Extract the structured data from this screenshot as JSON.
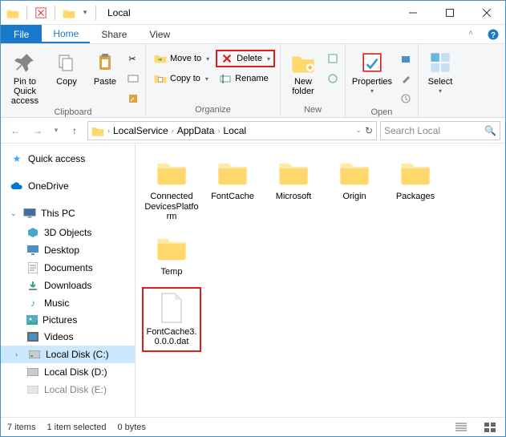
{
  "window": {
    "title": "Local"
  },
  "menu": {
    "file": "File",
    "home": "Home",
    "share": "Share",
    "view": "View"
  },
  "ribbon": {
    "clipboard": {
      "label": "Clipboard",
      "pin": "Pin to Quick access",
      "copy": "Copy",
      "paste": "Paste"
    },
    "organize": {
      "label": "Organize",
      "moveto": "Move to",
      "copyto": "Copy to",
      "delete": "Delete",
      "rename": "Rename"
    },
    "new": {
      "label": "New",
      "newfolder": "New folder"
    },
    "open": {
      "label": "Open",
      "properties": "Properties"
    },
    "select": {
      "label": "Select",
      "select": "Select"
    }
  },
  "breadcrumb": {
    "c1": "LocalService",
    "c2": "AppData",
    "c3": "Local"
  },
  "search": {
    "placeholder": "Search Local"
  },
  "sidebar": {
    "quick": "Quick access",
    "onedrive": "OneDrive",
    "thispc": "This PC",
    "objects3d": "3D Objects",
    "desktop": "Desktop",
    "documents": "Documents",
    "downloads": "Downloads",
    "music": "Music",
    "pictures": "Pictures",
    "videos": "Videos",
    "diskc": "Local Disk (C:)",
    "diskd": "Local Disk (D:)",
    "diske": "Local Disk (E:)"
  },
  "items": {
    "i0": "Connected DevicesPlatform",
    "i1": "FontCache",
    "i2": "Microsoft",
    "i3": "Origin",
    "i4": "Packages",
    "i5": "Temp",
    "i6": "FontCache3.0.0.0.dat"
  },
  "status": {
    "count": "7 items",
    "sel": "1 item selected",
    "size": "0 bytes"
  }
}
